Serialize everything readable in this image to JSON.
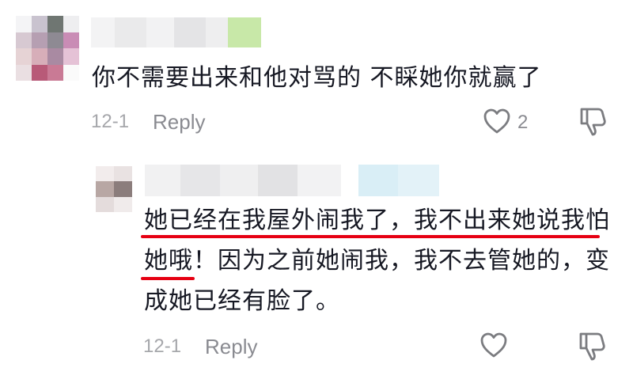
{
  "comments": [
    {
      "text": "你不需要出来和他对骂的 不睬她你就赢了",
      "date": "12-1",
      "reply_label": "Reply",
      "like_count": "2"
    },
    {
      "lines": [
        "她已经在我屋外闹我了，我不出来她说我怕",
        "她哦！因为之前她闹我，我不去管她的，变",
        "成她已经有脸了。"
      ],
      "date": "12-1",
      "reply_label": "Reply",
      "like_count": ""
    }
  ],
  "icons": {
    "like": "heart-outline-icon",
    "dislike": "thumbs-down-icon"
  },
  "colors": {
    "text": "#161823",
    "meta": "#a6a7ab",
    "highlight_underline": "#e60012"
  }
}
